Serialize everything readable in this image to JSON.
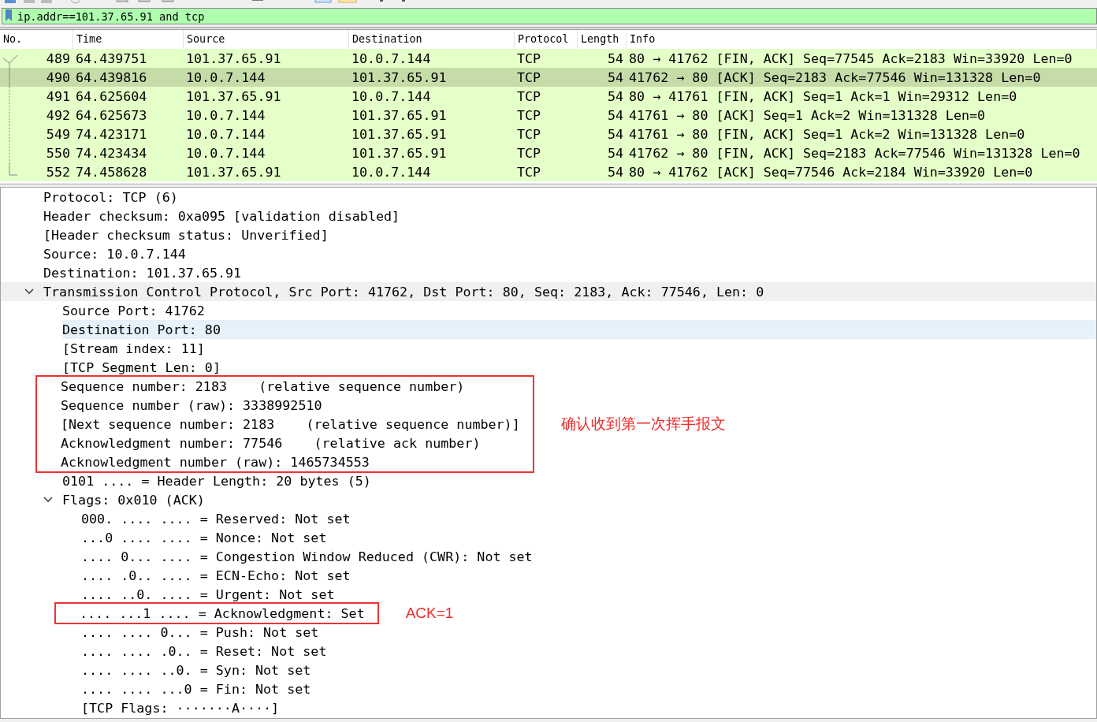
{
  "filter": {
    "value": "ip.addr==101.37.65.91 and tcp"
  },
  "packet_list": {
    "columns": [
      "No.",
      "Time",
      "Source",
      "Destination",
      "Protocol",
      "Length",
      "Info"
    ],
    "rows": [
      {
        "no": "489",
        "time": "64.439751",
        "source": "101.37.65.91",
        "destination": "10.0.7.144",
        "protocol": "TCP",
        "length": "54",
        "info": "80 → 41762 [FIN, ACK] Seq=77545 Ack=2183 Win=33920 Len=0",
        "selected": false
      },
      {
        "no": "490",
        "time": "64.439816",
        "source": "10.0.7.144",
        "destination": "101.37.65.91",
        "protocol": "TCP",
        "length": "54",
        "info": "41762 → 80 [ACK] Seq=2183 Ack=77546 Win=131328 Len=0",
        "selected": true
      },
      {
        "no": "491",
        "time": "64.625604",
        "source": "101.37.65.91",
        "destination": "10.0.7.144",
        "protocol": "TCP",
        "length": "54",
        "info": "80 → 41761 [FIN, ACK] Seq=1 Ack=1 Win=29312 Len=0",
        "selected": false
      },
      {
        "no": "492",
        "time": "64.625673",
        "source": "10.0.7.144",
        "destination": "101.37.65.91",
        "protocol": "TCP",
        "length": "54",
        "info": "41761 → 80 [ACK] Seq=1 Ack=2 Win=131328 Len=0",
        "selected": false
      },
      {
        "no": "549",
        "time": "74.423171",
        "source": "10.0.7.144",
        "destination": "101.37.65.91",
        "protocol": "TCP",
        "length": "54",
        "info": "41761 → 80 [FIN, ACK] Seq=1 Ack=2 Win=131328 Len=0",
        "selected": false
      },
      {
        "no": "550",
        "time": "74.423434",
        "source": "10.0.7.144",
        "destination": "101.37.65.91",
        "protocol": "TCP",
        "length": "54",
        "info": "41762 → 80 [FIN, ACK] Seq=2183 Ack=77546 Win=131328 Len=0",
        "selected": false
      },
      {
        "no": "552",
        "time": "74.458628",
        "source": "101.37.65.91",
        "destination": "10.0.7.144",
        "protocol": "TCP",
        "length": "54",
        "info": "80 → 41762 [ACK] Seq=77546 Ack=2184 Win=33920 Len=0",
        "selected": false
      }
    ]
  },
  "details": {
    "tree": [
      {
        "label": "Protocol: TCP (6)",
        "selected": false,
        "boxed": false
      },
      {
        "label": "Header checksum: 0xa095 [validation disabled]",
        "selected": false,
        "boxed": false
      },
      {
        "label": "[Header checksum status: Unverified]",
        "selected": false,
        "boxed": false
      },
      {
        "label": "Source: 10.0.7.144",
        "selected": false,
        "boxed": false
      },
      {
        "label": "Destination: 101.37.65.91",
        "selected": false,
        "boxed": false
      },
      {
        "label": "Transmission Control Protocol, Src Port: 41762, Dst Port: 80, Seq: 2183, Ack: 77546, Len: 0",
        "selected": false,
        "boxed": false,
        "header": true,
        "expanded": true,
        "children": [
          {
            "label": "Source Port: 41762",
            "selected": false,
            "boxed": false
          },
          {
            "label": "Destination Port: 80",
            "selected": true,
            "boxed": false
          },
          {
            "label": "[Stream index: 11]",
            "selected": false,
            "boxed": false
          },
          {
            "label": "[TCP Segment Len: 0]",
            "selected": false,
            "boxed": false
          },
          {
            "label": "Sequence number: 2183    (relative sequence number)",
            "selected": false,
            "boxed": true,
            "note": "确认收到第一次挥手报文"
          },
          {
            "label": "Sequence number (raw): 3338992510",
            "selected": false,
            "boxed": true
          },
          {
            "label": "[Next sequence number: 2183    (relative sequence number)]",
            "selected": false,
            "boxed": true
          },
          {
            "label": "Acknowledgment number: 77546    (relative ack number)",
            "selected": false,
            "boxed": true
          },
          {
            "label": "Acknowledgment number (raw): 1465734553",
            "selected": false,
            "boxed": true
          },
          {
            "label": "0101 .... = Header Length: 20 bytes (5)",
            "selected": false,
            "boxed": false
          },
          {
            "label": "Flags: 0x010 (ACK)",
            "selected": false,
            "boxed": false,
            "expanded": true,
            "children": [
              {
                "label": "000. .... .... = Reserved: Not set",
                "selected": false,
                "boxed": false
              },
              {
                "label": "...0 .... .... = Nonce: Not set",
                "selected": false,
                "boxed": false
              },
              {
                "label": ".... 0... .... = Congestion Window Reduced (CWR): Not set",
                "selected": false,
                "boxed": false
              },
              {
                "label": ".... .0.. .... = ECN-Echo: Not set",
                "selected": false,
                "boxed": false
              },
              {
                "label": ".... ..0. .... = Urgent: Not set",
                "selected": false,
                "boxed": false
              },
              {
                "label": ".... ...1 .... = Acknowledgment: Set",
                "selected": false,
                "boxed": true,
                "note": "ACK=1"
              },
              {
                "label": ".... .... 0... = Push: Not set",
                "selected": false,
                "boxed": false
              },
              {
                "label": ".... .... .0.. = Reset: Not set",
                "selected": false,
                "boxed": false
              },
              {
                "label": ".... .... ..0. = Syn: Not set",
                "selected": false,
                "boxed": false
              },
              {
                "label": ".... .... ...0 = Fin: Not set",
                "selected": false,
                "boxed": false
              },
              {
                "label": "[TCP Flags: ·······A····]",
                "selected": false,
                "boxed": false
              }
            ]
          }
        ]
      }
    ]
  }
}
